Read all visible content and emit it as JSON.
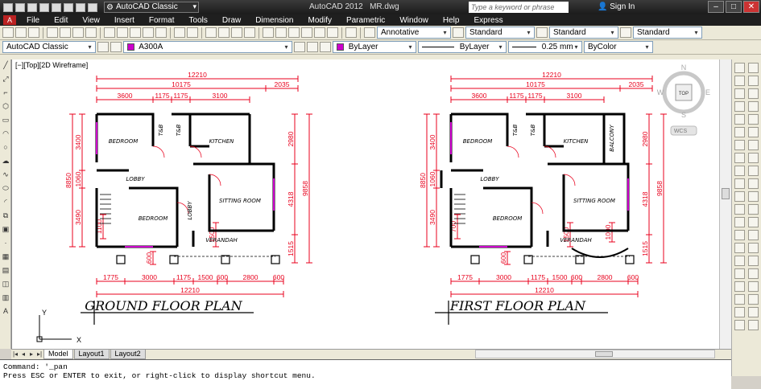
{
  "titlebar": {
    "workspace": "AutoCAD Classic",
    "app_title": "AutoCAD 2012",
    "file_name": "MR.dwg",
    "search_placeholder": "Type a keyword or phrase",
    "sign_in": "Sign In"
  },
  "menu": [
    "File",
    "Edit",
    "View",
    "Insert",
    "Format",
    "Tools",
    "Draw",
    "Dimension",
    "Modify",
    "Parametric",
    "Window",
    "Help",
    "Express"
  ],
  "toolbar1": {
    "annotative_label": "Annotative",
    "text_style": "Standard",
    "dim_style": "Standard",
    "multileader_style": "Standard"
  },
  "toolbar2": {
    "workspace": "AutoCAD Classic",
    "layer": "A300A",
    "color": "ByLayer",
    "linetype": "ByLayer",
    "lineweight": "0.25 mm",
    "plotstyle": "ByColor",
    "layer_color": "#cc00cc"
  },
  "viewport": {
    "label": "[−][Top][2D Wireframe]",
    "viewcube": {
      "north": "N",
      "south": "S",
      "east": "E",
      "west": "W",
      "face": "TOP",
      "wcs": "WCS"
    },
    "ucs": {
      "x": "X",
      "y": "Y"
    }
  },
  "ground_plan": {
    "title": "GROUND FLOOR PLAN",
    "rooms": [
      "BEDROOM",
      "T&B",
      "T&B",
      "KITCHEN",
      "LOBBY",
      "LOBBY",
      "BEDROOM",
      "SITTING ROOM",
      "VERANDAH"
    ],
    "top_dims": {
      "overall": "12210",
      "second": "10175",
      "right": "2035",
      "segments": [
        "3600",
        "1175",
        "1175",
        "3100"
      ]
    },
    "bottom_dims": {
      "overall": "12210",
      "segments": [
        "1775",
        "3000",
        "1175",
        "1500",
        "600",
        "2800",
        "600"
      ]
    },
    "left_dims": {
      "overall": "8850",
      "segments": [
        "3400",
        "1060",
        "3490"
      ],
      "small": "1100",
      "stub": "600"
    },
    "right_dims": {
      "overall": "9858",
      "segments": [
        "2980",
        "4318",
        "1515"
      ],
      "small": "1500"
    }
  },
  "first_plan": {
    "title": "FIRST FLOOR PLAN",
    "rooms": [
      "BEDROOM",
      "T&B",
      "T&B",
      "KITCHEN",
      "BALCONY",
      "LOBBY",
      "BEDROOM",
      "SITTING ROOM",
      "VERANDAH"
    ],
    "top_dims": {
      "overall": "12210",
      "second": "10175",
      "right": "2035",
      "segments": [
        "3600",
        "1175",
        "1175",
        "3100"
      ]
    },
    "bottom_dims": {
      "overall": "12210",
      "segments": [
        "1775",
        "3000",
        "1175",
        "1500",
        "600",
        "2800",
        "600"
      ]
    },
    "left_dims": {
      "overall": "8850",
      "segments": [
        "3400",
        "1060",
        "3490"
      ],
      "small": "700",
      "stub": "600"
    },
    "right_dims": {
      "overall": "9858",
      "segments": [
        "2980",
        "4318",
        "1515"
      ],
      "small": "1500",
      "extra": "1000"
    }
  },
  "tabs": [
    "Model",
    "Layout1",
    "Layout2"
  ],
  "command": {
    "line1": "Command: '_pan",
    "line2": "Press ESC or ENTER to exit, or right-click to display shortcut menu."
  },
  "colors": {
    "dim": "#e8001c",
    "wall": "#000000",
    "window": "#cc00cc",
    "accent": "#1a4a8a"
  }
}
